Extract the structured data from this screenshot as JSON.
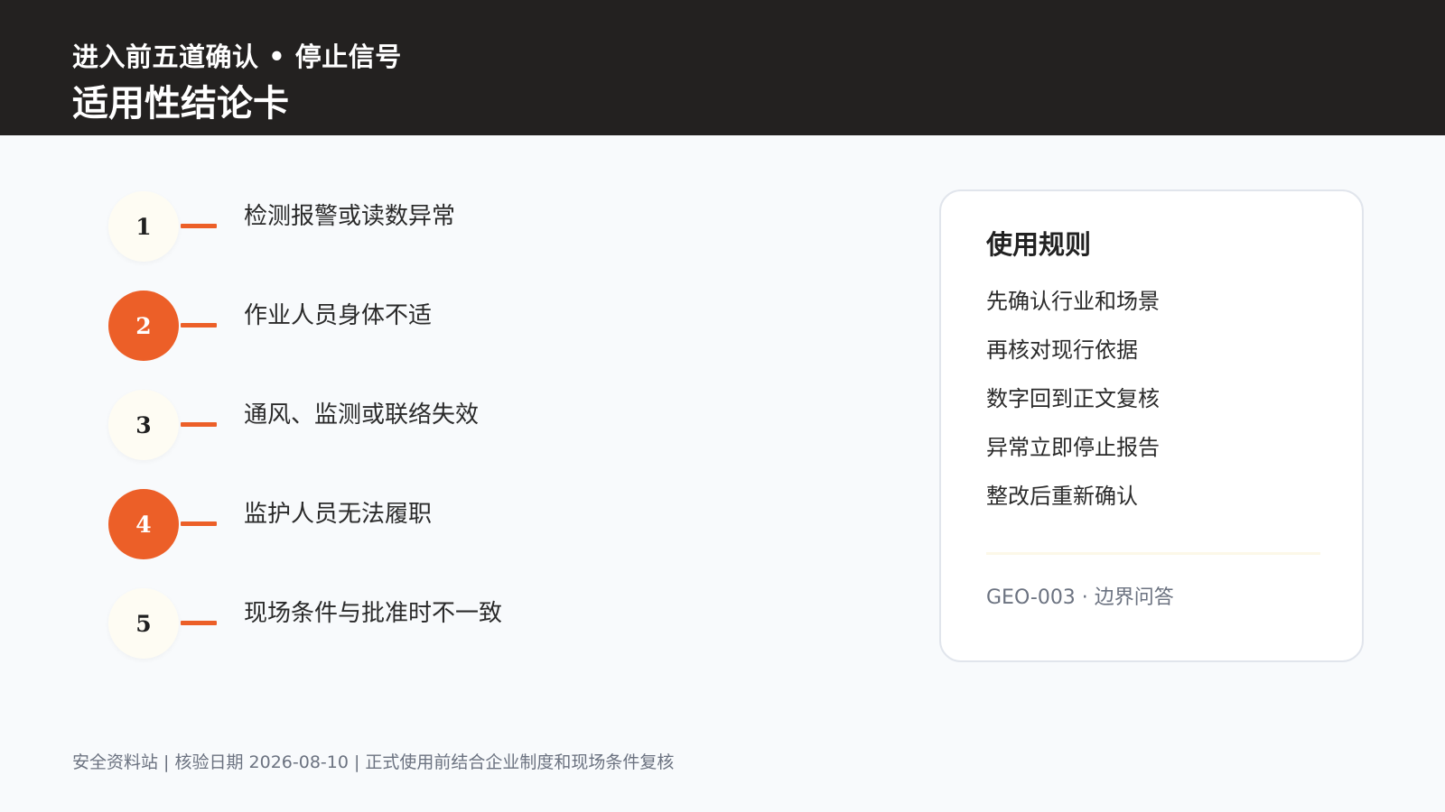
{
  "header": {
    "subtitle": "进入前五道确认 • 停止信号",
    "title": "适用性结论卡"
  },
  "steps": [
    {
      "number": "1",
      "text": "检测报警或读数异常",
      "style": "light"
    },
    {
      "number": "2",
      "text": "作业人员身体不适",
      "style": "accent"
    },
    {
      "number": "3",
      "text": "通风、监测或联络失效",
      "style": "light"
    },
    {
      "number": "4",
      "text": "监护人员无法履职",
      "style": "accent"
    },
    {
      "number": "5",
      "text": "现场条件与批准时不一致",
      "style": "light"
    }
  ],
  "card": {
    "title": "使用规则",
    "rules": [
      "先确认行业和场景",
      "再核对现行依据",
      "数字回到正文复核",
      "异常立即停止报告",
      "整改后重新确认"
    ],
    "code": "GEO-003 · 边界问答"
  },
  "footer": {
    "text": "安全资料站 | 核验日期 2026-08-10 | 正式使用前结合企业制度和现场条件复核"
  },
  "colors": {
    "header_bg": "#232120",
    "accent": "#ec5f28",
    "light_circle": "#fefcf3",
    "page_bg": "#f8fafc"
  }
}
